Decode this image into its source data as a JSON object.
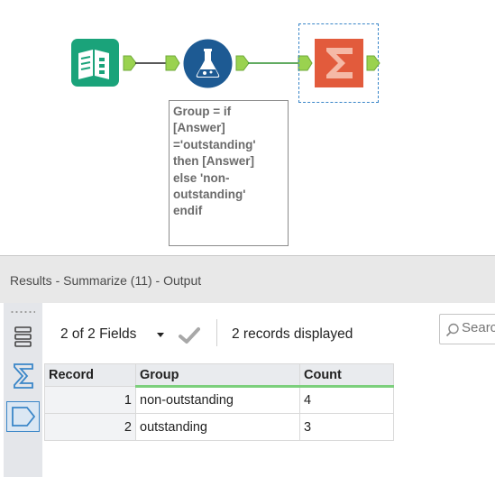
{
  "canvas": {
    "annotation": "Group = if\n[Answer]\n='outstanding'\nthen [Answer]\nelse 'non-\noutstanding'\nendif",
    "tools": [
      {
        "name": "input-data-tool",
        "icon": "book-icon",
        "color": "#1aa37a"
      },
      {
        "name": "formula-tool",
        "icon": "flask-icon",
        "color": "#1d5a93"
      },
      {
        "name": "summarize-tool",
        "icon": "sigma-icon",
        "color": "#e25b3c"
      }
    ],
    "connector_color": "#7cc242"
  },
  "results": {
    "title": "Results - Summarize (11) - Output",
    "fields_label": "2 of 2 Fields",
    "records_label": "2 records displayed",
    "search_placeholder": "Search",
    "columns": [
      "Record",
      "Group",
      "Count"
    ],
    "rows": [
      {
        "record": "1",
        "group": "non-outstanding",
        "count": "4"
      },
      {
        "record": "2",
        "group": "outstanding",
        "count": "3"
      }
    ]
  }
}
